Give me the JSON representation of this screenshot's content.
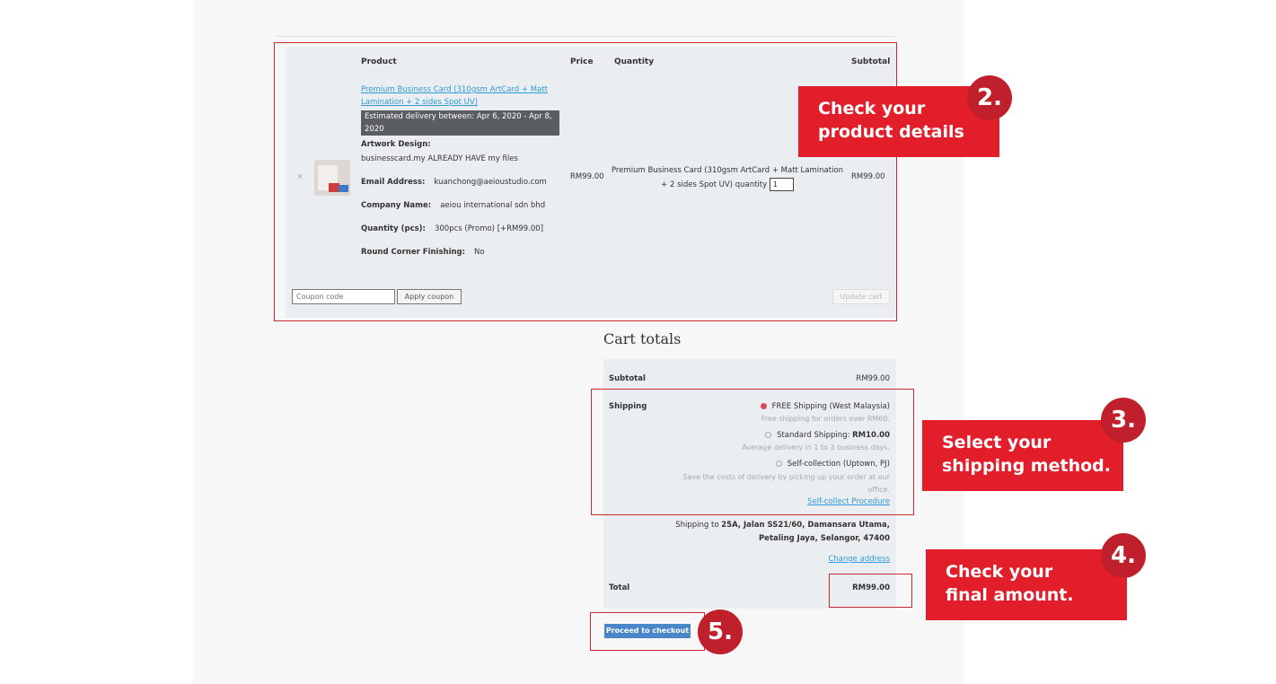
{
  "cart": {
    "headers": {
      "product": "Product",
      "price": "Price",
      "quantity": "Quantity",
      "subtotal": "Subtotal"
    },
    "item": {
      "remove": "×",
      "name": "Premium Business Card (310gsm ArtCard + Matt Lamination + 2 sides Spot UV)",
      "delivery": "Estimated delivery between: Apr 6, 2020 - Apr 8, 2020",
      "artwork_label": "Artwork Design:",
      "artwork_value": "businesscard.my ALREADY HAVE my files",
      "email_label": "Email Address:",
      "email_value": "kuanchong@aeioustudio.com",
      "company_label": "Company Name:",
      "company_value": "aeiou international sdn bhd",
      "qtypcs_label": "Quantity (pcs):",
      "qtypcs_value": "300pcs (Promo) [+RM99.00]",
      "corner_label": "Round Corner Finishing:",
      "corner_value": "No",
      "price": "RM99.00",
      "quantity_text": "Premium Business Card (310gsm ArtCard + Matt Lamination + 2 sides Spot UV) quantity",
      "quantity_value": "1",
      "subtotal": "RM99.00"
    },
    "coupon_placeholder": "Coupon code",
    "apply_label": "Apply coupon",
    "update_label": "Update cart"
  },
  "totals": {
    "title": "Cart totals",
    "subtotal_label": "Subtotal",
    "subtotal_value": "RM99.00",
    "shipping_label": "Shipping",
    "options": [
      {
        "label": "FREE Shipping (West Malaysia)",
        "hint": "Free shipping for orders over RM60.",
        "selected": true
      },
      {
        "label": "Standard Shipping:",
        "price": "RM10.00",
        "hint": "Average delivery in 1 to 3 business days.",
        "selected": false
      },
      {
        "label": "Self-collection (Uptown, PJ)",
        "hint1": "Save the costs of delivery by picking up your order at our",
        "hint2": "office.",
        "selected": false
      }
    ],
    "self_collect_link": "Self-collect Procedure",
    "shipping_to_prefix": "Shipping to",
    "shipping_to_line1": "25A, Jalan SS21/60, Damansara Utama,",
    "shipping_to_line2": "Petaling Jaya, Selangor, 47400",
    "change_address": "Change address",
    "total_label": "Total",
    "total_value": "RM99.00",
    "checkout_label": "Proceed to checkout"
  },
  "annotations": [
    {
      "number": "2.",
      "line1": "Check your",
      "line2": "product details"
    },
    {
      "number": "3.",
      "line1": "Select your",
      "line2": "shipping method."
    },
    {
      "number": "4.",
      "line1": "Check your",
      "line2": "final amount."
    },
    {
      "number": "5."
    }
  ],
  "colors": {
    "accent_red": "#e31e2b",
    "badge_red": "#c0202c",
    "link_blue": "#2e9ad6",
    "button_blue": "#4a86c8"
  }
}
